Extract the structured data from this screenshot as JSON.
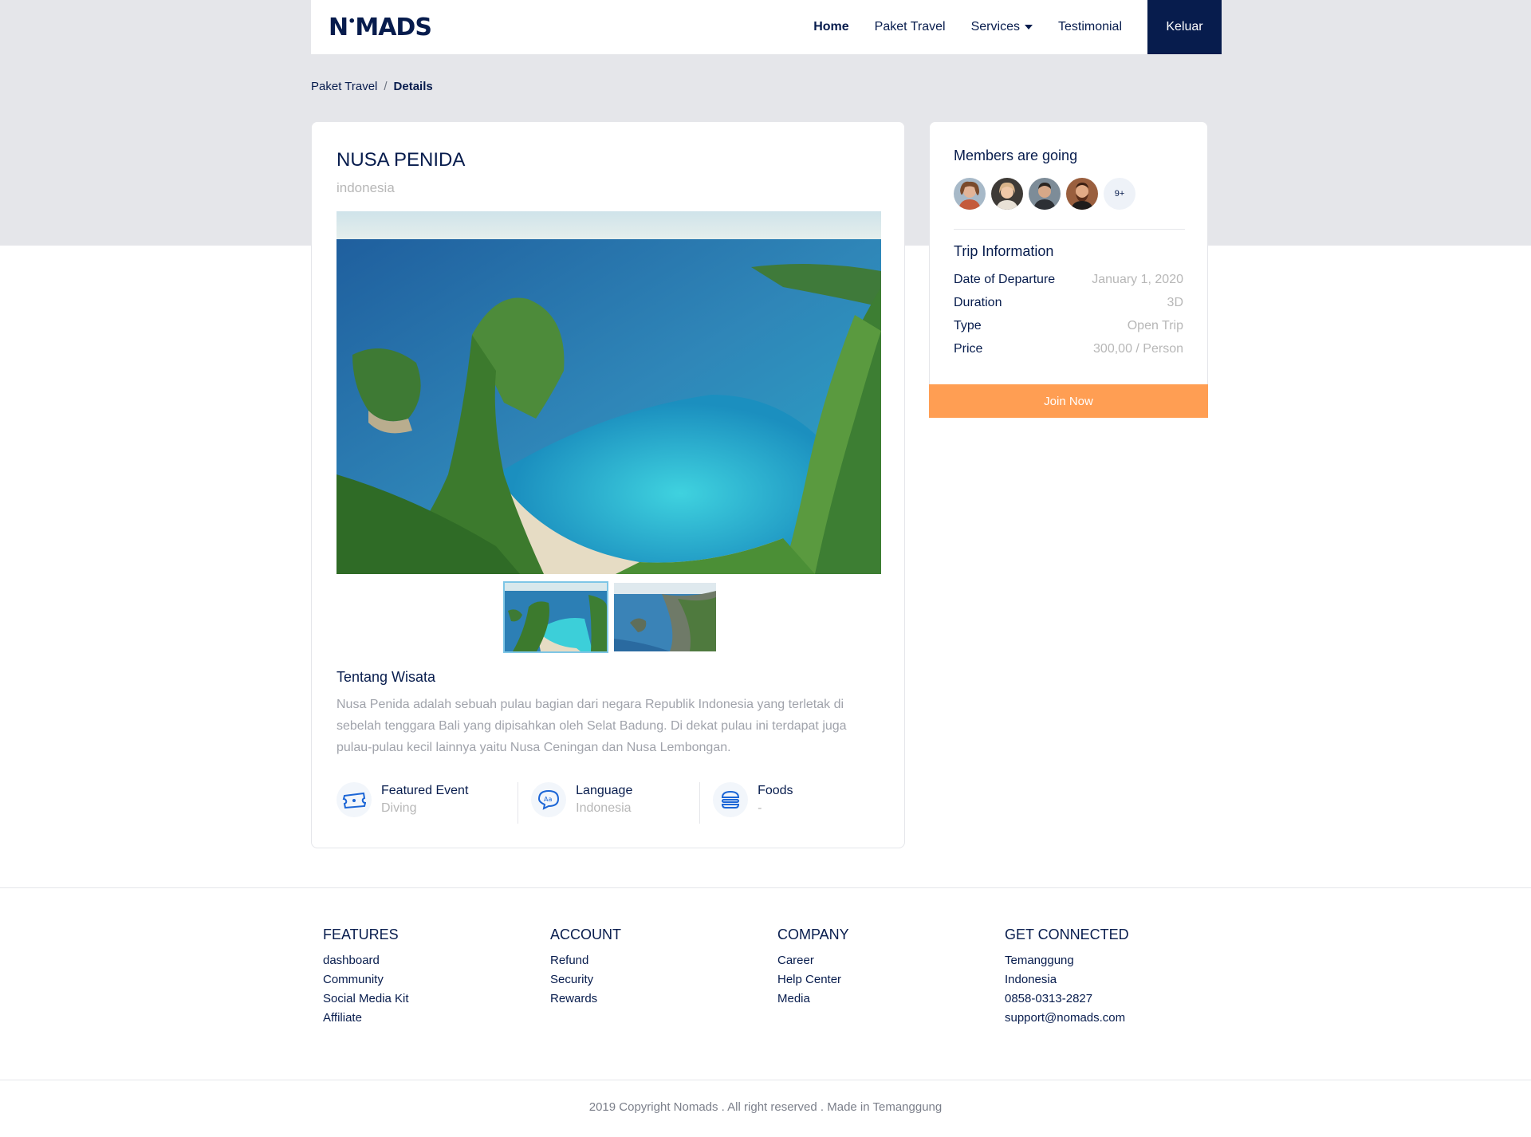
{
  "brand": {
    "logo_text": "NOMADS"
  },
  "nav": {
    "home": "Home",
    "paket_travel": "Paket Travel",
    "services": "Services",
    "testimonial": "Testimonial",
    "logout": "Keluar"
  },
  "breadcrumb": {
    "parent": "Paket Travel",
    "separator": "/",
    "current": "Details"
  },
  "place": {
    "title": "NUSA PENIDA",
    "country": "indonesia"
  },
  "gallery": {
    "main_image": "kelingking-beach-photo",
    "thumbnails": [
      "kelingking-beach-thumb",
      "coastal-cliffs-thumb"
    ]
  },
  "about": {
    "title": "Tentang Wisata",
    "text": "Nusa Penida adalah sebuah pulau bagian dari negara Republik Indonesia yang terletak di sebelah tenggara Bali yang dipisahkan oleh Selat Badung. Di dekat pulau ini terdapat juga pulau-pulau kecil lainnya yaitu Nusa Ceningan dan Nusa Lembongan."
  },
  "features": [
    {
      "icon": "ticket-icon",
      "title": "Featured Event",
      "value": "Diving"
    },
    {
      "icon": "language-icon",
      "title": "Language",
      "value": "Indonesia"
    },
    {
      "icon": "burger-icon",
      "title": "Foods",
      "value": "-"
    }
  ],
  "members": {
    "title": "Members are going",
    "more": "9+"
  },
  "trip": {
    "title": "Trip Information",
    "rows": [
      {
        "label": "Date of Departure",
        "value": "January 1, 2020"
      },
      {
        "label": "Duration",
        "value": "3D"
      },
      {
        "label": "Type",
        "value": "Open Trip"
      },
      {
        "label": "Price",
        "value": "300,00 / Person"
      }
    ],
    "join": "Join Now"
  },
  "footer": {
    "features": {
      "head": "FEATURES",
      "items": [
        "dashboard",
        "Community",
        "Social Media Kit",
        "Affiliate"
      ]
    },
    "account": {
      "head": "ACCOUNT",
      "items": [
        "Refund",
        "Security",
        "Rewards"
      ]
    },
    "company": {
      "head": "COMPANY",
      "items": [
        "Career",
        "Help Center",
        "Media"
      ]
    },
    "connected": {
      "head": "GET CONNECTED",
      "items": [
        "Temanggung",
        "Indonesia",
        "0858-0313-2827",
        "support@nomads.com"
      ]
    },
    "copyright": "2019 Copyright Nomads . All right reserved . Made in Temanggung"
  },
  "colors": {
    "navy": "#071c4d",
    "orange": "#ff9e53",
    "band": "#e5e6ea",
    "muted": "#b7b7b7"
  }
}
